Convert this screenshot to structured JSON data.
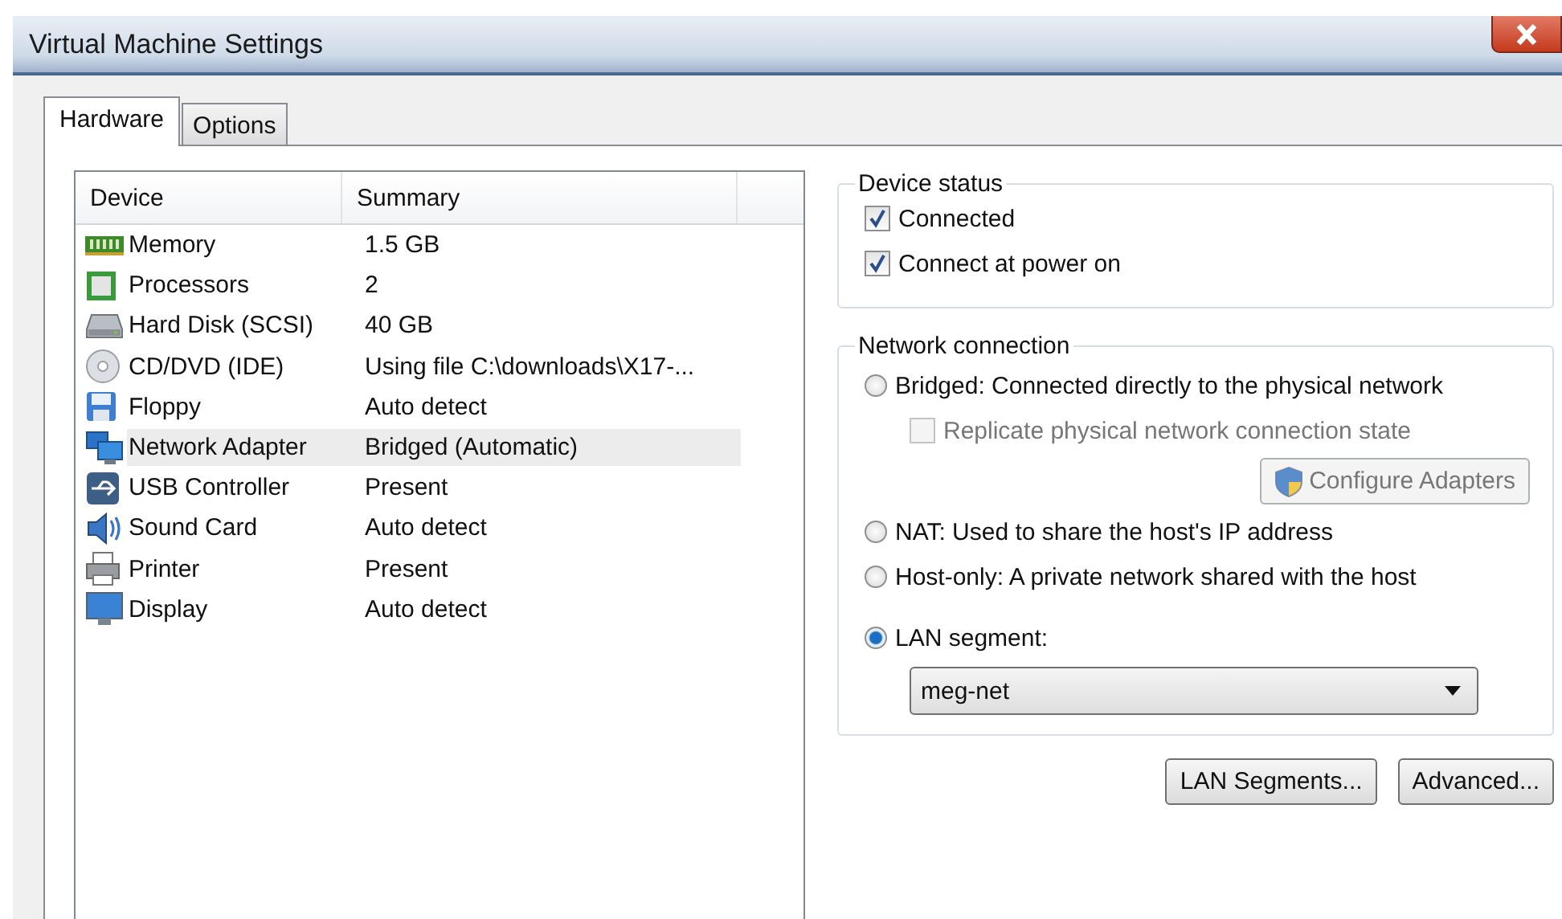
{
  "window": {
    "title": "Virtual Machine Settings"
  },
  "tabs": [
    {
      "label": "Hardware",
      "selected": true
    },
    {
      "label": "Options",
      "selected": false
    }
  ],
  "device_table": {
    "columns": [
      "Device",
      "Summary"
    ],
    "rows": [
      {
        "kind": "memory",
        "device": "Memory",
        "summary": "1.5 GB",
        "selected": false
      },
      {
        "kind": "processor",
        "device": "Processors",
        "summary": "2",
        "selected": false
      },
      {
        "kind": "disk",
        "device": "Hard Disk (SCSI)",
        "summary": "40 GB",
        "selected": false
      },
      {
        "kind": "cd",
        "device": "CD/DVD (IDE)",
        "summary": "Using file C:\\downloads\\X17-...",
        "selected": false
      },
      {
        "kind": "floppy",
        "device": "Floppy",
        "summary": "Auto detect",
        "selected": false
      },
      {
        "kind": "network",
        "device": "Network Adapter",
        "summary": "Bridged (Automatic)",
        "selected": true
      },
      {
        "kind": "usb",
        "device": "USB Controller",
        "summary": "Present",
        "selected": false
      },
      {
        "kind": "sound",
        "device": "Sound Card",
        "summary": "Auto detect",
        "selected": false
      },
      {
        "kind": "printer",
        "device": "Printer",
        "summary": "Present",
        "selected": false
      },
      {
        "kind": "display",
        "device": "Display",
        "summary": "Auto detect",
        "selected": false
      }
    ]
  },
  "device_status": {
    "title": "Device status",
    "options": [
      {
        "label": "Connected",
        "checked": true
      },
      {
        "label": "Connect at power on",
        "checked": true
      }
    ]
  },
  "network_connection": {
    "title": "Network connection",
    "bridged": {
      "label": "Bridged: Connected directly to the physical network",
      "selected": false
    },
    "replicate": {
      "label": "Replicate physical network connection state",
      "checked": false,
      "disabled": true
    },
    "configure_button": {
      "label": "Configure Adapters",
      "disabled": true
    },
    "nat": {
      "label": "NAT: Used to share the host's IP address",
      "selected": false
    },
    "host_only": {
      "label": "Host-only: A private network shared with the host",
      "selected": false
    },
    "lan_segment": {
      "label": "LAN segment:",
      "selected": true,
      "value": "meg-net"
    }
  },
  "buttons": [
    {
      "label": "LAN Segments..."
    },
    {
      "label": "Advanced..."
    }
  ]
}
